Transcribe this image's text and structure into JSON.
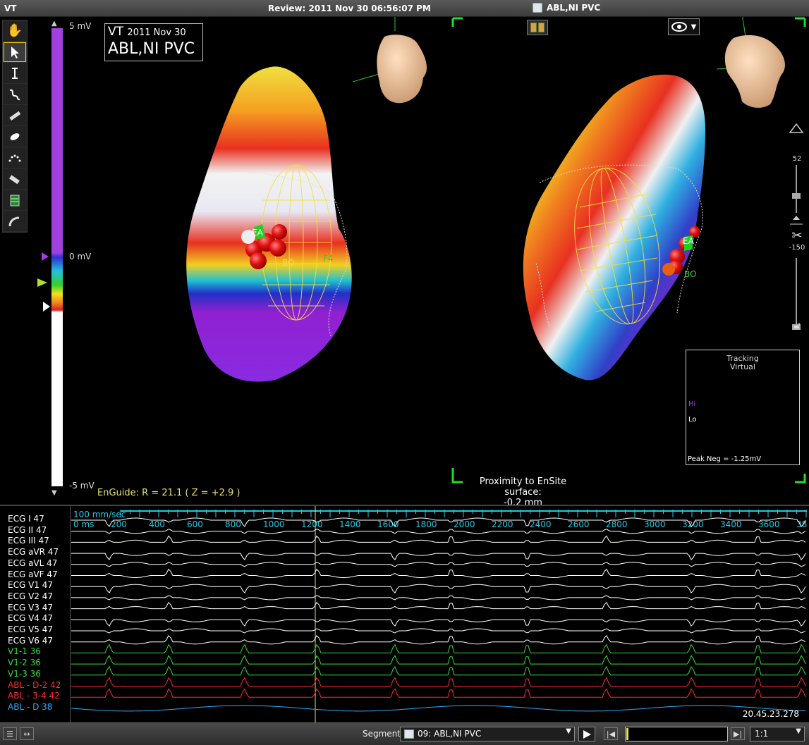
{
  "window": {
    "app_label": "VT",
    "review_title": "Review: 2011 Nov 30 06:56:07 PM",
    "segment_title": "ABL,NI PVC"
  },
  "map_info": {
    "label_vt": "VT",
    "date": "2011 Nov 30",
    "map_name": "ABL,NI PVC"
  },
  "voltage_scale": {
    "max": "5 mV",
    "mid": "0 mV",
    "min": "-5 mV"
  },
  "enguide": {
    "text": "EnGuide: R =  21.1   ( Z =  +2.9 )"
  },
  "proximity": {
    "label": "Proximity to EnSite surface:",
    "value": "-0.2 mm"
  },
  "markers": {
    "ea": "EA",
    "bo": "BO",
    "f4": "F4"
  },
  "tracking": {
    "title1": "Tracking",
    "title2": "Virtual",
    "hi": "Hi",
    "lo": "Lo",
    "peak": "Peak Neg = -1.25mV"
  },
  "right_slider": {
    "top_value": "52",
    "bottom_value": "-150"
  },
  "ecg": {
    "speed": "100 mm/sec",
    "start": "0 ms",
    "ticks": [
      "200",
      "400",
      "600",
      "800",
      "1000",
      "1200",
      "1400",
      "1600",
      "1800",
      "2000",
      "2200",
      "2400",
      "2600",
      "2800",
      "3000",
      "3200",
      "3400",
      "3600",
      "38"
    ],
    "timestamp": "20.45.23.278",
    "leads": [
      {
        "label": "ECG I 47",
        "color": "#ffffff"
      },
      {
        "label": "ECG II 47",
        "color": "#ffffff"
      },
      {
        "label": "ECG III 47",
        "color": "#ffffff"
      },
      {
        "label": "ECG aVR 47",
        "color": "#ffffff"
      },
      {
        "label": "ECG aVL 47",
        "color": "#ffffff"
      },
      {
        "label": "ECG aVF 47",
        "color": "#ffffff"
      },
      {
        "label": "ECG V1 47",
        "color": "#ffffff"
      },
      {
        "label": "ECG V2 47",
        "color": "#ffffff"
      },
      {
        "label": "ECG V3 47",
        "color": "#ffffff"
      },
      {
        "label": "ECG V4 47",
        "color": "#ffffff"
      },
      {
        "label": "ECG V5 47",
        "color": "#ffffff"
      },
      {
        "label": "ECG V6 47",
        "color": "#ffffff"
      },
      {
        "label": "V1-1 36",
        "color": "#33dd33"
      },
      {
        "label": "V1-2 36",
        "color": "#33dd33"
      },
      {
        "label": "V1-3 36",
        "color": "#33dd33"
      },
      {
        "label": "ABL - D-2 42",
        "color": "#ff2a2a"
      },
      {
        "label": "ABL - 3-4 42",
        "color": "#ff2a2a"
      },
      {
        "label": "ABL - D 38",
        "color": "#33a8ff"
      }
    ]
  },
  "bottombar": {
    "segment_label": "Segment",
    "segment_value": "09: ABL,NI PVC",
    "speed_value": "1:1"
  },
  "colors": {
    "purple": "#8a2be2",
    "ruler_cyan": "#22c8e8",
    "enguide_yellow": "#e8e070",
    "corner_green": "#22dd22"
  }
}
